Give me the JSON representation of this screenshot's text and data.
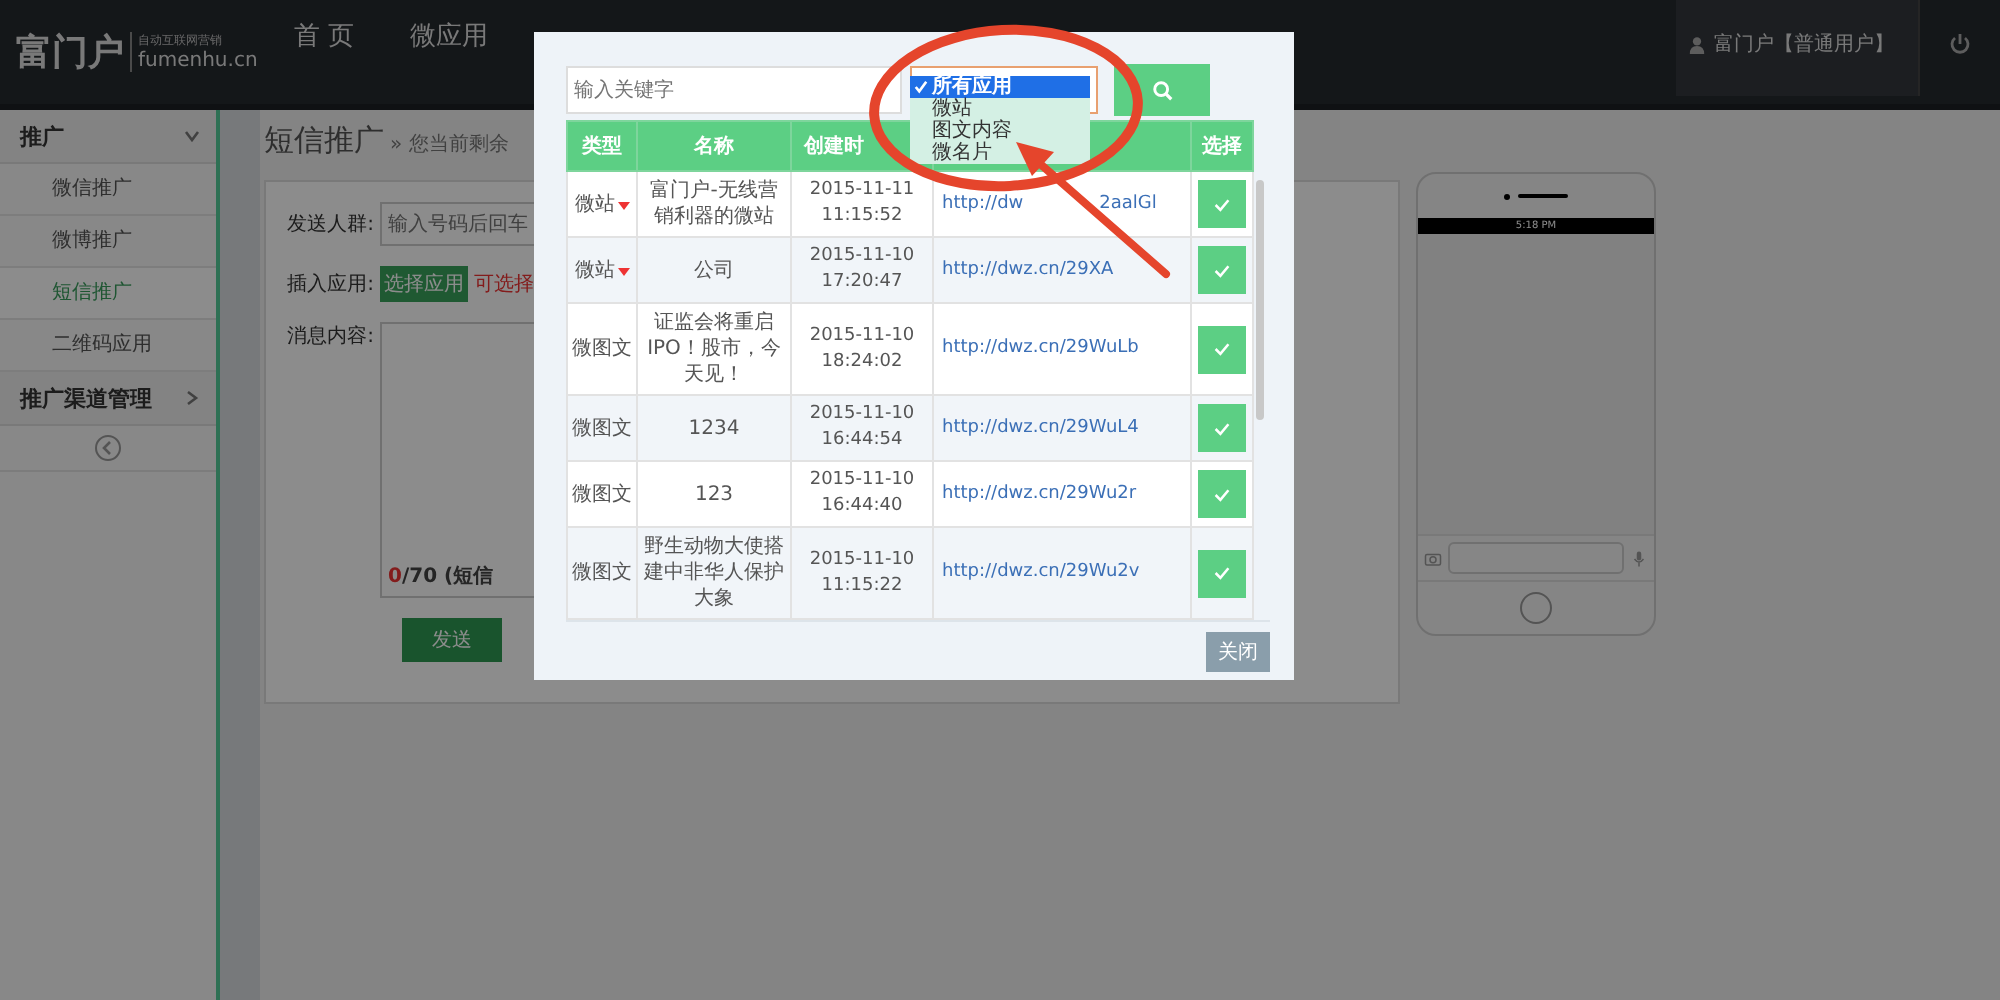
{
  "header": {
    "logo": "富门户",
    "logo_tagline": "自动互联网营销",
    "logo_domain": "fumenhu.cn",
    "nav": [
      {
        "label": "首 页",
        "selected": false
      },
      {
        "label": "微应用",
        "selected": false
      }
    ],
    "user": "富门户【普通用户】"
  },
  "sidebar": {
    "sections": [
      {
        "label": "推广",
        "expanded": true,
        "children": [
          {
            "label": "微信推广",
            "selected": false
          },
          {
            "label": "微博推广",
            "selected": false
          },
          {
            "label": "短信推广",
            "selected": true
          },
          {
            "label": "二维码应用",
            "selected": false
          }
        ]
      },
      {
        "label": "推广渠道管理",
        "expanded": false
      }
    ]
  },
  "page": {
    "title": "短信推广",
    "subtitle": "» 您当前剩余",
    "recipients": {
      "label": "发送人群:",
      "placeholder": "输入号码后回车"
    },
    "insert_app": {
      "label": "插入应用:",
      "button": "选择应用",
      "hint": "可选择"
    },
    "message": {
      "label": "消息内容:",
      "count": "0",
      "limit": "/70 (短信"
    },
    "send_button": "发送"
  },
  "phone": {
    "time": "5:18 PM"
  },
  "modal": {
    "search_placeholder": "输入关键字",
    "filter_options": [
      {
        "label": "所有应用",
        "selected": true
      },
      {
        "label": "微站",
        "selected": false
      },
      {
        "label": "图文内容",
        "selected": false
      },
      {
        "label": "微名片",
        "selected": false
      }
    ],
    "columns": [
      "类型",
      "名称",
      "创建时"
    ],
    "select_column": "选择",
    "rows": [
      {
        "type": "微站",
        "has_menu": true,
        "name": "富门户-无线营销利器的微站",
        "created_date": "2015-11-11",
        "created_time": "11:15:52",
        "link": "http://dw",
        "link_tail": "2aalGl"
      },
      {
        "type": "微站",
        "has_menu": true,
        "name": "公司",
        "created_date": "2015-11-10",
        "created_time": "17:20:47",
        "link": "http://dwz.cn/29XA"
      },
      {
        "type": "微图文",
        "has_menu": false,
        "name": "证监会将重启IPO！股市，今天见！",
        "created_date": "2015-11-10",
        "created_time": "18:24:02",
        "link": "http://dwz.cn/29WuLb"
      },
      {
        "type": "微图文",
        "has_menu": false,
        "name": "1234",
        "created_date": "2015-11-10",
        "created_time": "16:44:54",
        "link": "http://dwz.cn/29WuL4"
      },
      {
        "type": "微图文",
        "has_menu": false,
        "name": "123",
        "created_date": "2015-11-10",
        "created_time": "16:44:40",
        "link": "http://dwz.cn/29Wu2r"
      },
      {
        "type": "微图文",
        "has_menu": false,
        "name": "野生动物大使搭建中非华人保护大象",
        "created_date": "2015-11-10",
        "created_time": "11:15:22",
        "link": "http://dwz.cn/29Wu2v"
      }
    ],
    "close_button": "关闭"
  }
}
